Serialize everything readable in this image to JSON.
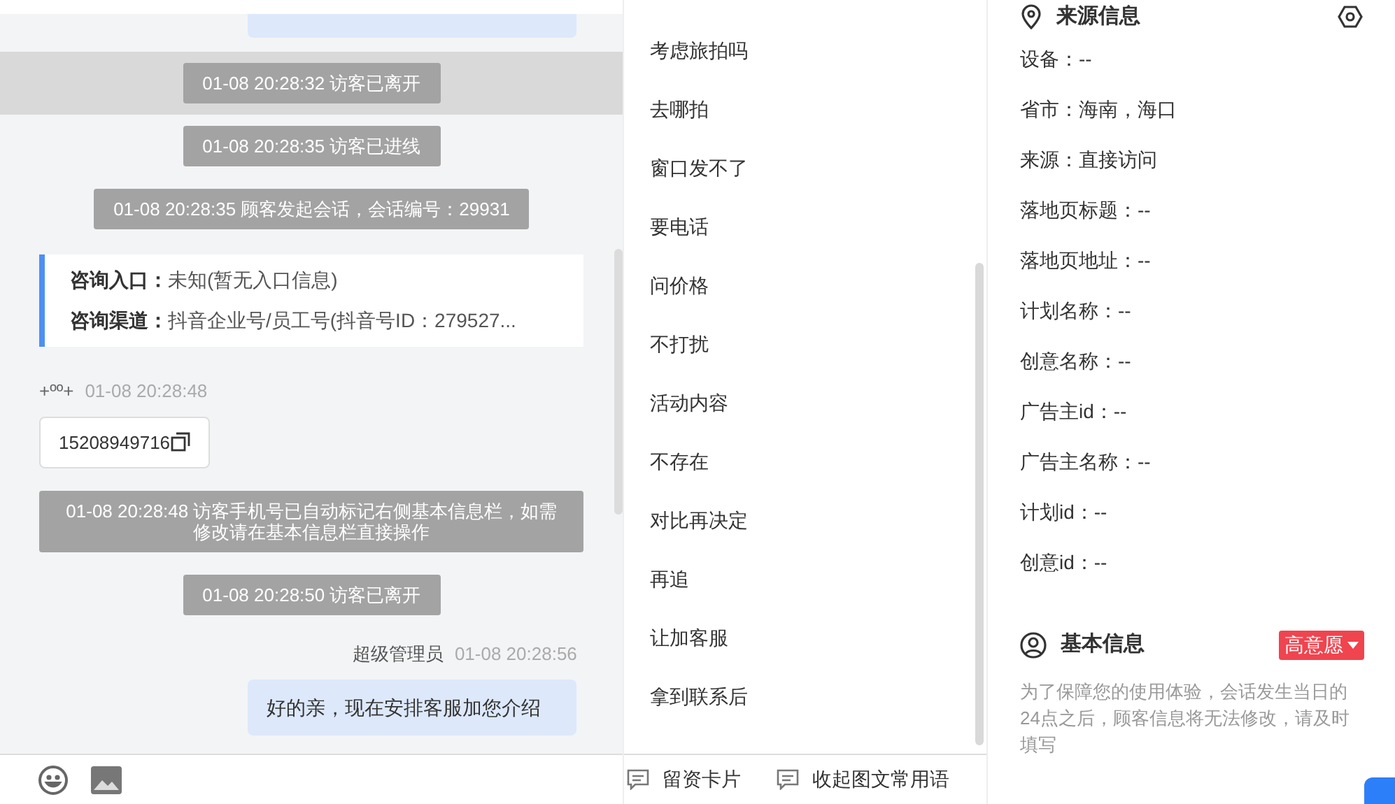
{
  "chat": {
    "events": [
      {
        "kind": "system",
        "text": "01-08 20:28:32 访客已离开",
        "selected": true
      },
      {
        "kind": "system",
        "text": "01-08 20:28:35 访客已进线",
        "selected": false
      },
      {
        "kind": "system",
        "text": "01-08 20:28:35 顾客发起会话，会话编号：29931",
        "selected": false
      },
      {
        "kind": "info",
        "lines": [
          {
            "label": "咨询入口：",
            "value": "未知(暂无入口信息)"
          },
          {
            "label": "咨询渠道：",
            "value": "抖音企业号/员工号(抖音号ID：279527..."
          }
        ]
      },
      {
        "kind": "visitor",
        "name": "+ºº+",
        "time": "01-08 20:28:48",
        "text": "15208949716"
      },
      {
        "kind": "system",
        "text": "01-08 20:28:48 访客手机号已自动标记右侧基本信息栏，如需修改请在基本信息栏直接操作",
        "selected": false
      },
      {
        "kind": "system",
        "text": "01-08 20:28:50 访客已离开",
        "selected": false
      },
      {
        "kind": "agent",
        "name": "超级管理员",
        "time": "01-08 20:28:56",
        "text": "好的亲，现在安排客服加您介绍"
      }
    ],
    "footer_tools": [
      "留资卡片",
      "收起图文常用语"
    ]
  },
  "phrases": [
    "考虑旅拍吗",
    "去哪拍",
    "窗口发不了",
    "要电话",
    "问价格",
    "不打扰",
    "活动内容",
    "不存在",
    "对比再决定",
    "再追",
    "让加客服",
    "拿到联系后"
  ],
  "source_info": {
    "title": "来源信息",
    "fields": [
      "设备：--",
      "省市：海南，海口",
      "来源：直接访问",
      "落地页标题：--",
      "落地页地址：--",
      "计划名称：--",
      "创意名称：--",
      "广告主id：--",
      "广告主名称：--",
      "计划id：--",
      "创意id：--"
    ]
  },
  "basic_info": {
    "title": "基本信息",
    "intent": "高意愿",
    "notice": "为了保障您的使用体验，会话发生当日的24点之后，顾客信息将无法修改，请及时填写"
  }
}
